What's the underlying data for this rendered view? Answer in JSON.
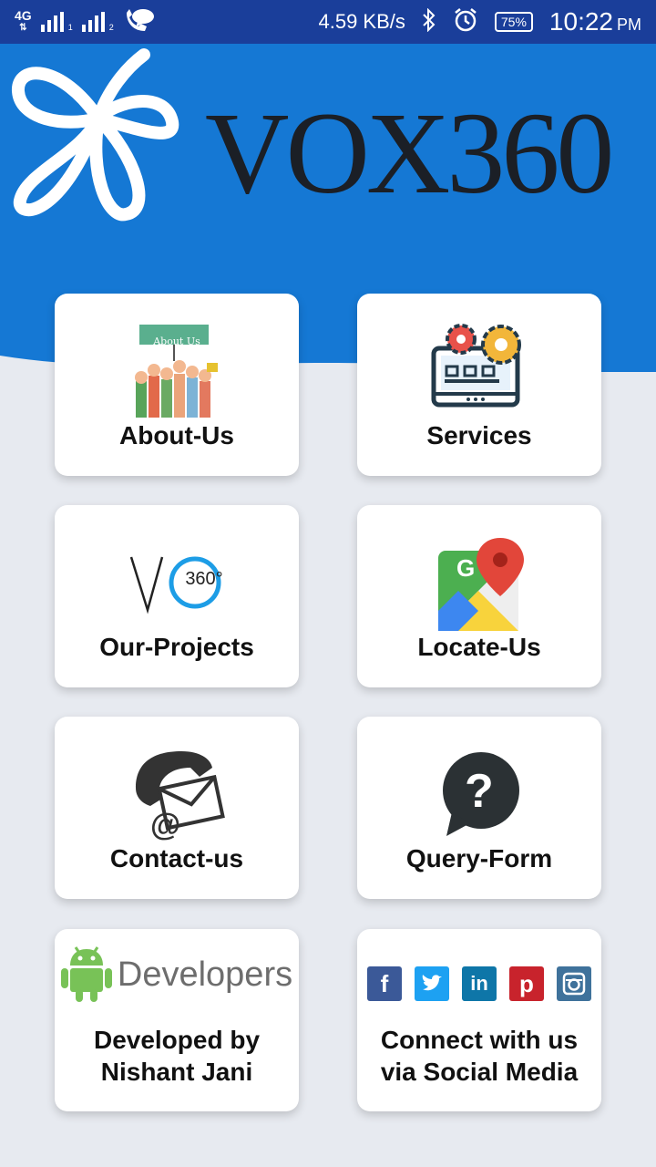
{
  "status_bar": {
    "network": "4G",
    "sim1": "1",
    "sim2": "2",
    "speed": "4.59 KB/s",
    "battery": "75%",
    "time": "10:22",
    "ampm": "PM"
  },
  "header": {
    "brand": "VOX360"
  },
  "cards": {
    "about": {
      "label": "About-Us",
      "sign": "About Us"
    },
    "services": {
      "label": "Services"
    },
    "projects": {
      "label": "Our-Projects",
      "logo_text": "360°"
    },
    "locate": {
      "label": "Locate-Us"
    },
    "contact": {
      "label": "Contact-us"
    },
    "query": {
      "label": "Query-Form"
    },
    "developers": {
      "line1": "Developed by",
      "line2": "Nishant Jani",
      "logo_text": "Developers"
    },
    "social": {
      "line1": "Connect with us",
      "line2": "via Social Media"
    }
  },
  "colors": {
    "status_bar": "#1a3e9a",
    "header_blue": "#1578d4",
    "background": "#e7eaf0"
  }
}
